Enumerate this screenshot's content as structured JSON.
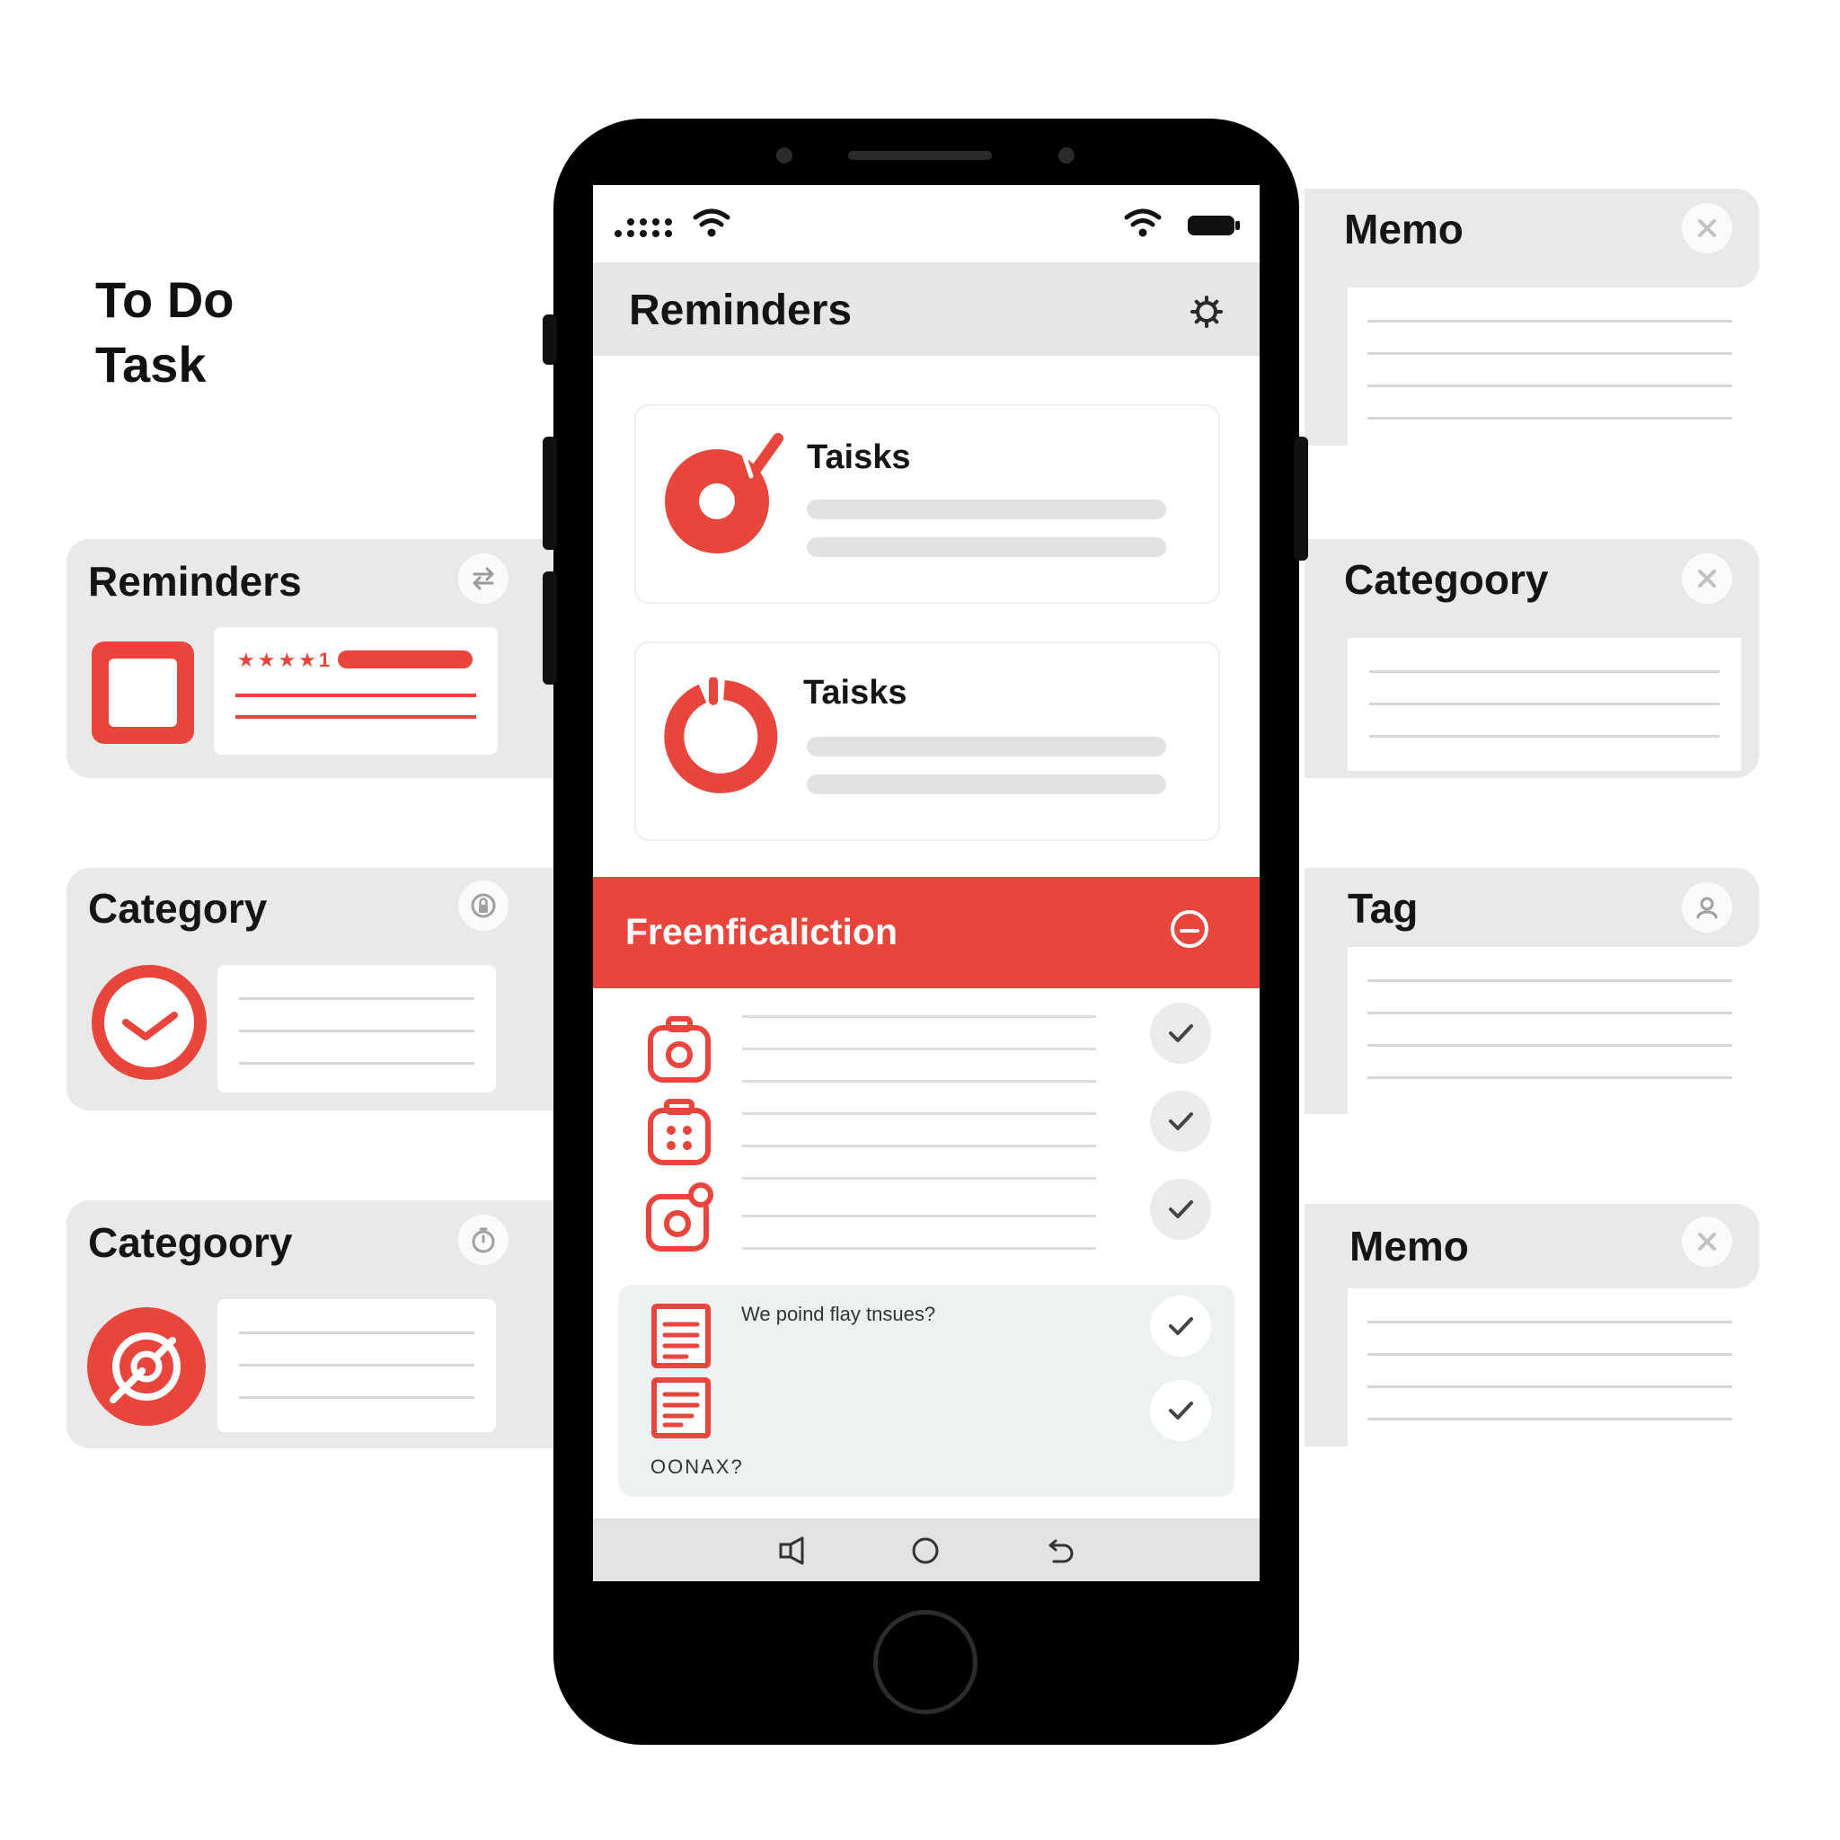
{
  "hero": {
    "line1": "To Do",
    "line2": "Task"
  },
  "left_cards": [
    {
      "title": "Reminders",
      "stars": "★★★★1"
    },
    {
      "title": "Category"
    },
    {
      "title": "Categoory"
    }
  ],
  "right_cards": [
    {
      "title": "Memo"
    },
    {
      "title": "Categoory"
    },
    {
      "title": "Tag"
    },
    {
      "title": "Memo"
    }
  ],
  "app": {
    "title": "Reminders",
    "tasks": [
      {
        "title": "Taisks"
      },
      {
        "title": "Taisks"
      }
    ],
    "band_title": "Freenficaliction",
    "memo": {
      "question": "We poind flay tnsues?",
      "footer": "OONAX?"
    }
  },
  "colors": {
    "accent": "#e8453d",
    "card_bg": "#e9e9e9",
    "bar_bg": "#e6e6e6"
  },
  "icons": {
    "status": [
      "signal-dots-icon",
      "wifi-icon",
      "wifi-icon",
      "battery-icon"
    ],
    "nav": [
      "back-icon",
      "home-icon",
      "return-icon"
    ]
  }
}
